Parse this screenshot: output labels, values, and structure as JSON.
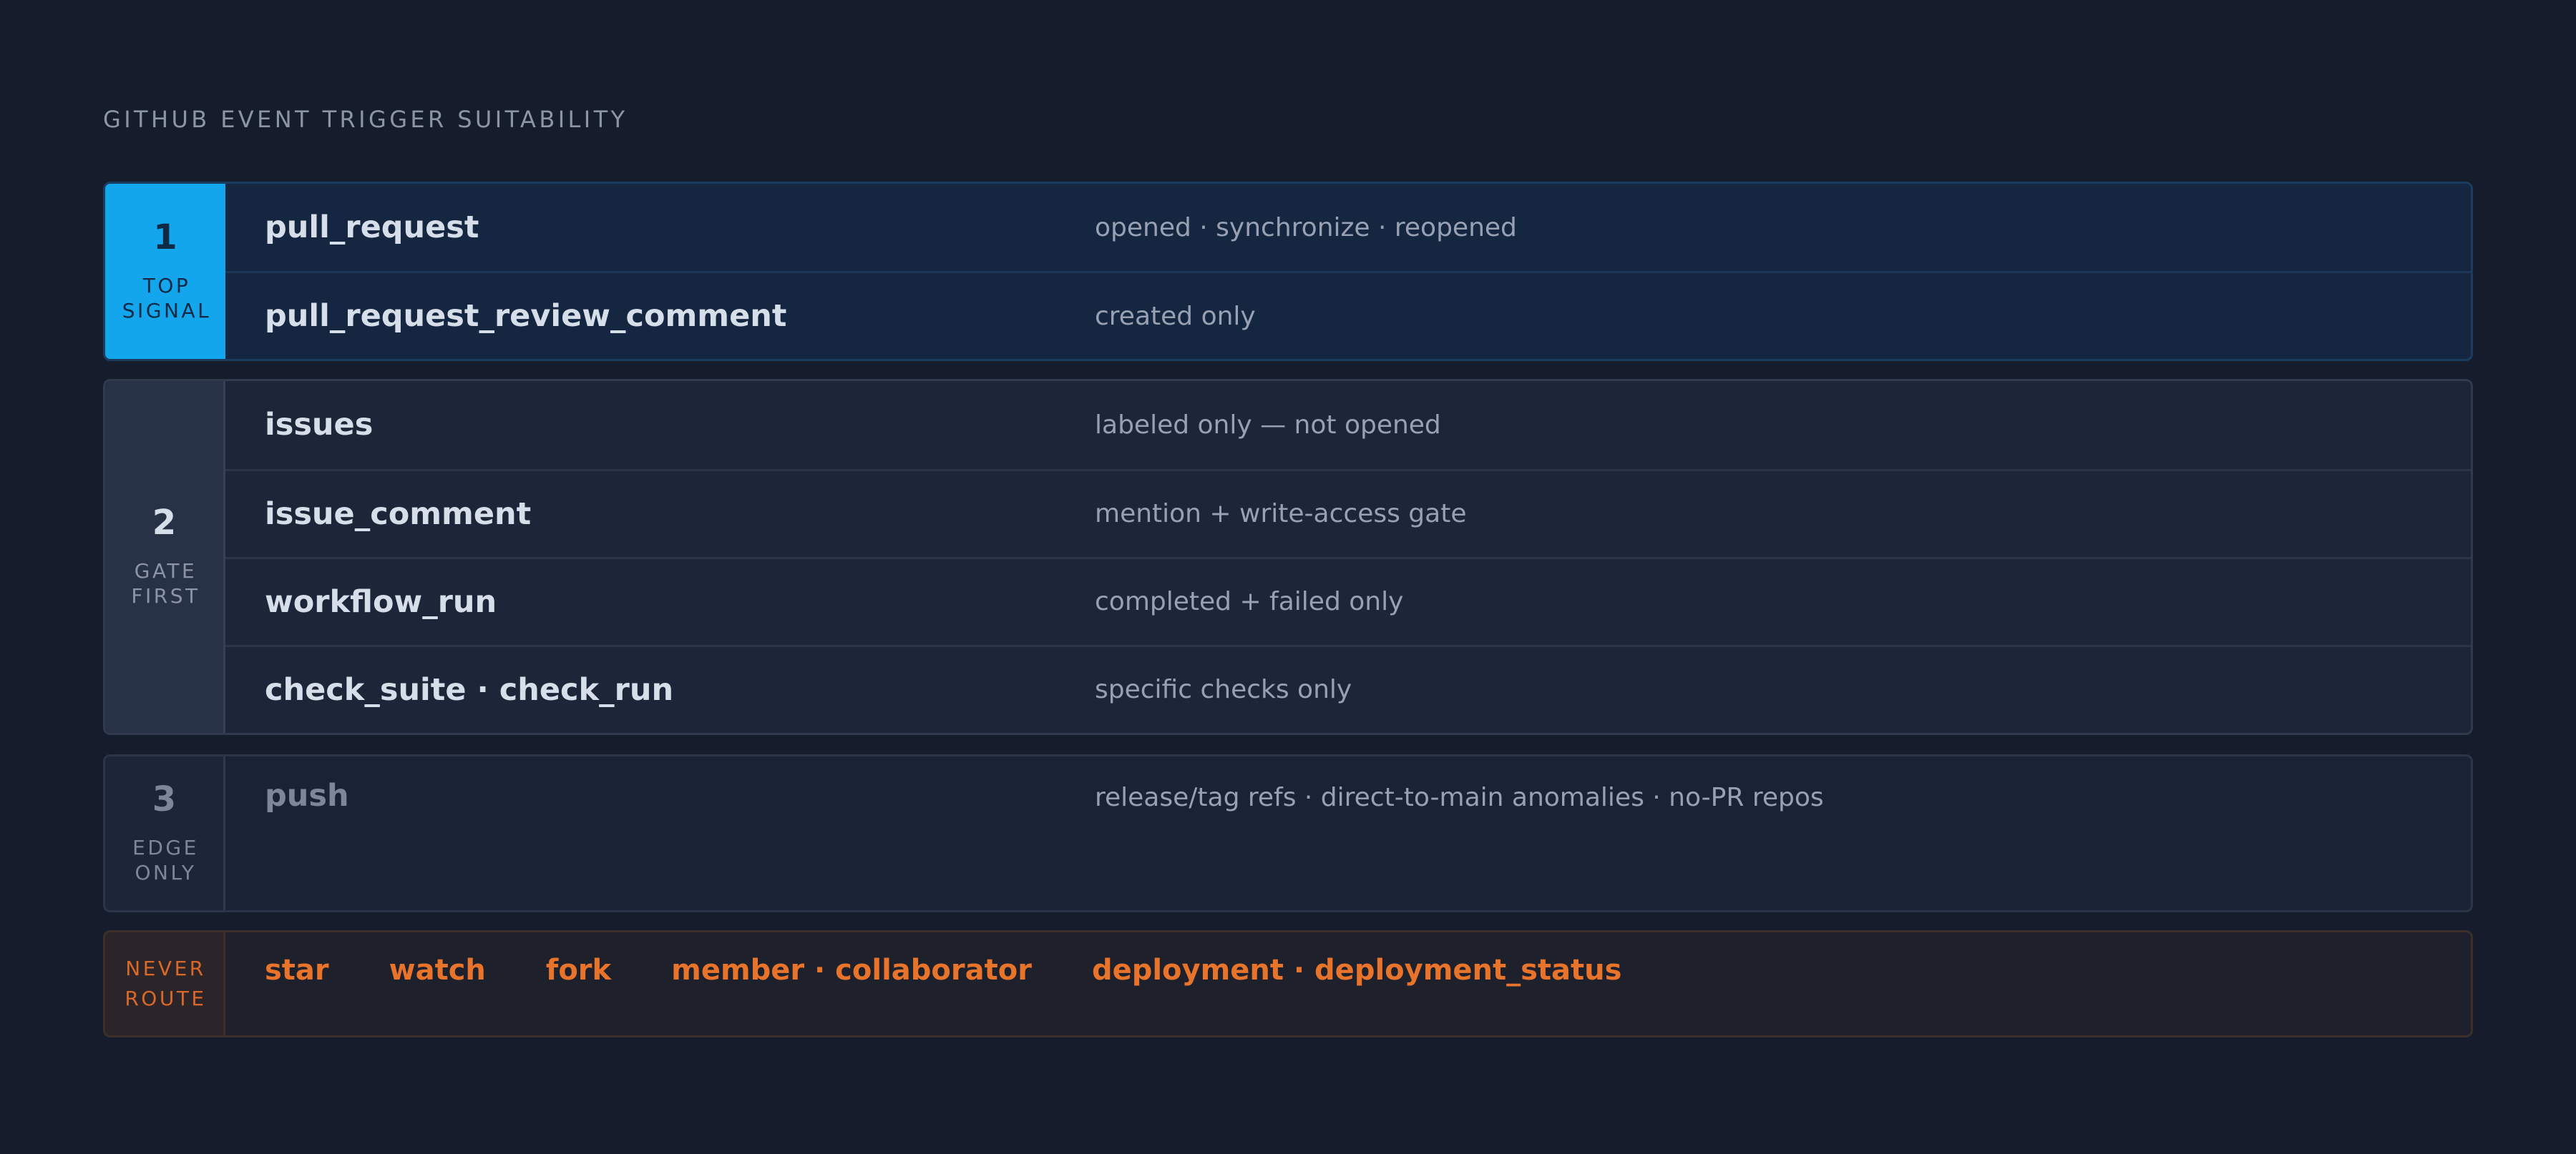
{
  "title": "GITHUB EVENT TRIGGER SUITABILITY",
  "colors": {
    "background": "#151c2c",
    "tier1_accent": "#14a6ec",
    "never_accent": "#e8732b",
    "text_primary": "#d6deea",
    "text_secondary": "#97a1b1"
  },
  "tiers": [
    {
      "number": "1",
      "label_line1": "TOP",
      "label_line2": "SIGNAL",
      "rows": [
        {
          "event": "pull_request",
          "condition": "opened · synchronize · reopened"
        },
        {
          "event": "pull_request_review_comment",
          "condition": "created only"
        }
      ]
    },
    {
      "number": "2",
      "label_line1": "GATE",
      "label_line2": "FIRST",
      "rows": [
        {
          "event": "issues",
          "condition": "labeled only — not opened"
        },
        {
          "event": "issue_comment",
          "condition": "mention + write-access gate"
        },
        {
          "event": "workflow_run",
          "condition": "completed + failed only"
        },
        {
          "event": "check_suite · check_run",
          "condition": "specific checks only"
        }
      ]
    },
    {
      "number": "3",
      "label_line1": "EDGE",
      "label_line2": "ONLY",
      "rows": [
        {
          "event": "push",
          "condition": "release/tag refs · direct-to-main anomalies · no-PR repos"
        }
      ]
    }
  ],
  "never": {
    "label_line1": "NEVER",
    "label_line2": "ROUTE",
    "items": [
      "star",
      "watch",
      "fork",
      "member · collaborator",
      "deployment · deployment_status"
    ]
  }
}
